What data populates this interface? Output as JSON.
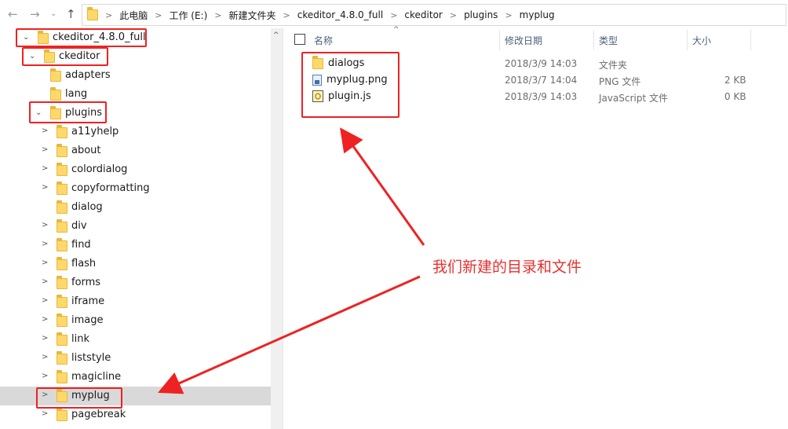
{
  "toolbar": {
    "back_icon": "left-arrow-icon",
    "forward_icon": "right-arrow-icon",
    "dropdown_icon": "chevron-down-icon",
    "up_icon": "up-arrow-icon"
  },
  "breadcrumb": [
    "此电脑",
    "工作 (E:)",
    "新建文件夹",
    "ckeditor_4.8.0_full",
    "ckeditor",
    "plugins",
    "myplug"
  ],
  "tree": {
    "root": "ckeditor_4.8.0_full",
    "ckeditor": "ckeditor",
    "adapters": "adapters",
    "lang": "lang",
    "plugins": "plugins",
    "children": [
      "a11yhelp",
      "about",
      "colordialog",
      "copyformatting",
      "dialog",
      "div",
      "find",
      "flash",
      "forms",
      "iframe",
      "image",
      "link",
      "liststyle",
      "magicline",
      "myplug",
      "pagebreak"
    ]
  },
  "columns": {
    "name": "名称",
    "date": "修改日期",
    "type": "类型",
    "size": "大小"
  },
  "files": [
    {
      "name": "dialogs",
      "date": "2018/3/9 14:03",
      "type": "文件夹",
      "size": "",
      "icon": "folder-icon"
    },
    {
      "name": "myplug.png",
      "date": "2018/3/7 14:04",
      "type": "PNG 文件",
      "size": "2 KB",
      "icon": "image-file-icon"
    },
    {
      "name": "plugin.js",
      "date": "2018/3/9 14:03",
      "type": "JavaScript 文件",
      "size": "0 KB",
      "icon": "js-file-icon"
    }
  ],
  "annotation": "我们新建的目录和文件",
  "colors": {
    "accent_red": "#e22",
    "folder_yellow": "#ffd86b",
    "selection": "#d9d9d9"
  }
}
